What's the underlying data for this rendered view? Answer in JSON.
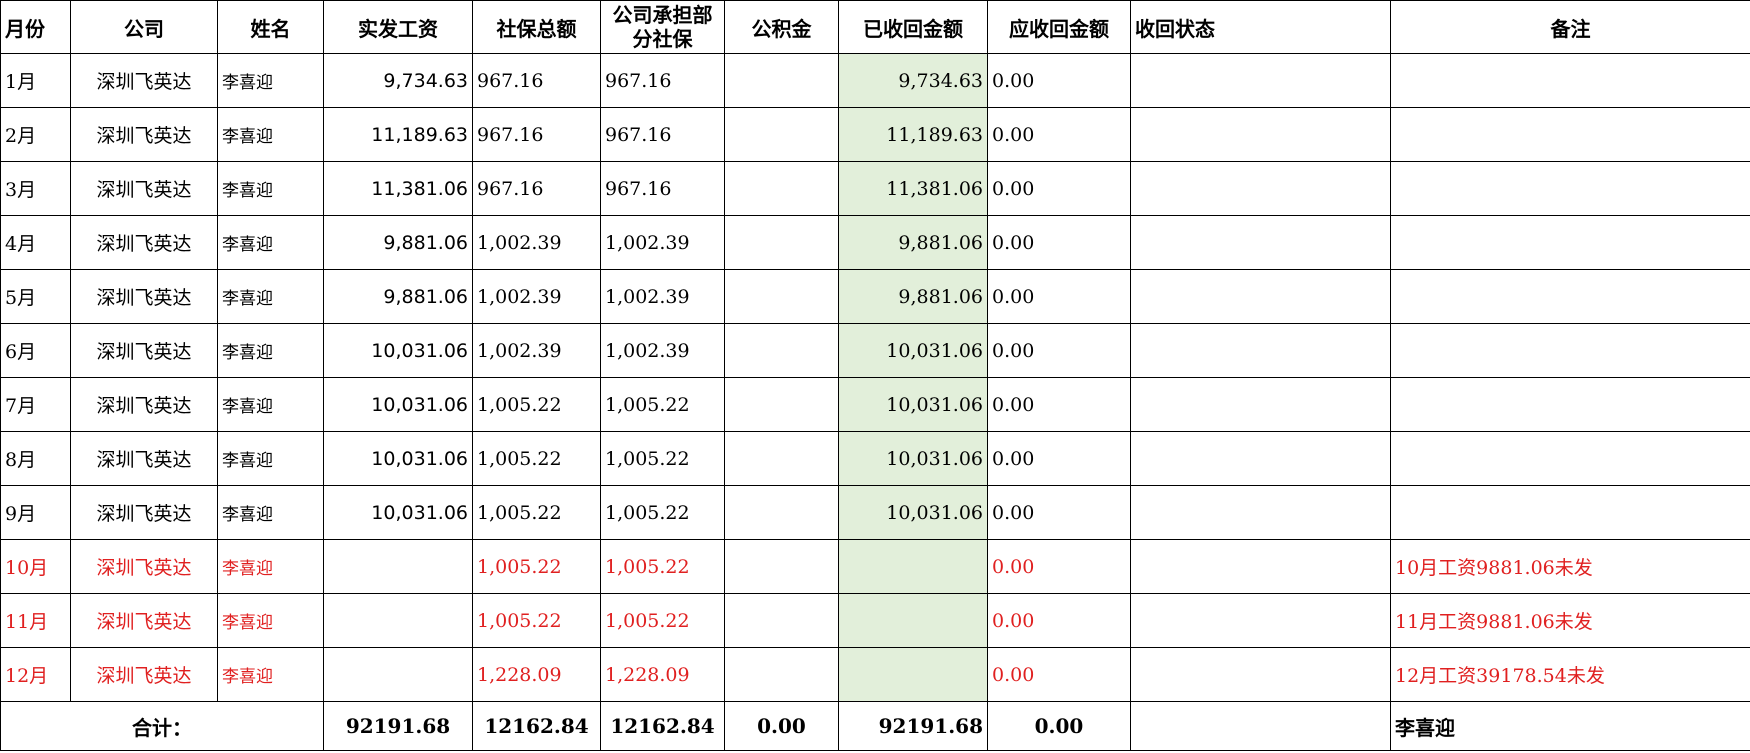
{
  "headers": {
    "month": "月份",
    "company": "公司",
    "name": "姓名",
    "net_salary": "实发工资",
    "social_total": "社保总额",
    "company_social": "公司承担部分社保",
    "housing_fund": "公积金",
    "recovered": "已收回金额",
    "receivable": "应收回金额",
    "status": "收回状态",
    "remark": "备注"
  },
  "rows": [
    {
      "month": "1月",
      "company": "深圳飞英达",
      "name": "李喜迎",
      "net_salary": "9,734.63",
      "social_total": "967.16",
      "company_social": "967.16",
      "housing_fund": "",
      "recovered": "9,734.63",
      "receivable": "0.00",
      "status": "",
      "remark": ""
    },
    {
      "month": "2月",
      "company": "深圳飞英达",
      "name": "李喜迎",
      "net_salary": "11,189.63",
      "social_total": "967.16",
      "company_social": "967.16",
      "housing_fund": "",
      "recovered": "11,189.63",
      "receivable": "0.00",
      "status": "",
      "remark": ""
    },
    {
      "month": "3月",
      "company": "深圳飞英达",
      "name": "李喜迎",
      "net_salary": "11,381.06",
      "social_total": "967.16",
      "company_social": "967.16",
      "housing_fund": "",
      "recovered": "11,381.06",
      "receivable": "0.00",
      "status": "",
      "remark": ""
    },
    {
      "month": "4月",
      "company": "深圳飞英达",
      "name": "李喜迎",
      "net_salary": "9,881.06",
      "social_total": "1,002.39",
      "company_social": "1,002.39",
      "housing_fund": "",
      "recovered": "9,881.06",
      "receivable": "0.00",
      "status": "",
      "remark": ""
    },
    {
      "month": "5月",
      "company": "深圳飞英达",
      "name": "李喜迎",
      "net_salary": "9,881.06",
      "social_total": "1,002.39",
      "company_social": "1,002.39",
      "housing_fund": "",
      "recovered": "9,881.06",
      "receivable": "0.00",
      "status": "",
      "remark": ""
    },
    {
      "month": "6月",
      "company": "深圳飞英达",
      "name": "李喜迎",
      "net_salary": "10,031.06",
      "social_total": "1,002.39",
      "company_social": "1,002.39",
      "housing_fund": "",
      "recovered": "10,031.06",
      "receivable": "0.00",
      "status": "",
      "remark": ""
    },
    {
      "month": "7月",
      "company": "深圳飞英达",
      "name": "李喜迎",
      "net_salary": "10,031.06",
      "social_total": "1,005.22",
      "company_social": "1,005.22",
      "housing_fund": "",
      "recovered": "10,031.06",
      "receivable": "0.00",
      "status": "",
      "remark": ""
    },
    {
      "month": "8月",
      "company": "深圳飞英达",
      "name": "李喜迎",
      "net_salary": "10,031.06",
      "social_total": "1,005.22",
      "company_social": "1,005.22",
      "housing_fund": "",
      "recovered": "10,031.06",
      "receivable": "0.00",
      "status": "",
      "remark": ""
    },
    {
      "month": "9月",
      "company": "深圳飞英达",
      "name": "李喜迎",
      "net_salary": "10,031.06",
      "social_total": "1,005.22",
      "company_social": "1,005.22",
      "housing_fund": "",
      "recovered": "10,031.06",
      "receivable": "0.00",
      "status": "",
      "remark": ""
    },
    {
      "month": "10月",
      "company": "深圳飞英达",
      "name": "李喜迎",
      "net_salary": "",
      "social_total": "1,005.22",
      "company_social": "1,005.22",
      "housing_fund": "",
      "recovered": "",
      "receivable": "0.00",
      "status": "",
      "remark": "10月工资9881.06未发"
    },
    {
      "month": "11月",
      "company": "深圳飞英达",
      "name": "李喜迎",
      "net_salary": "",
      "social_total": "1,005.22",
      "company_social": "1,005.22",
      "housing_fund": "",
      "recovered": "",
      "receivable": "0.00",
      "status": "",
      "remark": "11月工资9881.06未发"
    },
    {
      "month": "12月",
      "company": "深圳飞英达",
      "name": "李喜迎",
      "net_salary": "",
      "social_total": "1,228.09",
      "company_social": "1,228.09",
      "housing_fund": "",
      "recovered": "",
      "receivable": "0.00",
      "status": "",
      "remark": "12月工资39178.54未发"
    }
  ],
  "totals": {
    "label": "合计：",
    "net_salary": "92191.68",
    "social_total": "12162.84",
    "company_social": "12162.84",
    "housing_fund": "0.00",
    "recovered": "92191.68",
    "receivable": "0.00",
    "status": "",
    "remark": "李喜迎"
  },
  "colors": {
    "text": "#000000",
    "unpaid_text": "#e02020",
    "recovered_fill": "#e2efda",
    "grid": "#000000"
  }
}
